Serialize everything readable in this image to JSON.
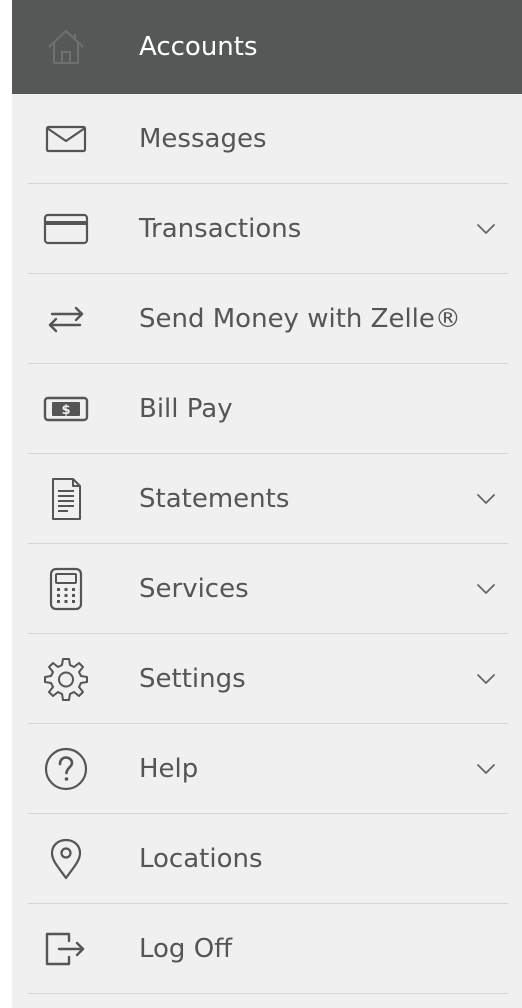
{
  "menu": {
    "items": [
      {
        "label": "Accounts",
        "icon": "home-icon",
        "active": true,
        "expandable": false
      },
      {
        "label": "Messages",
        "icon": "envelope-icon",
        "active": false,
        "expandable": false
      },
      {
        "label": "Transactions",
        "icon": "credit-card-icon",
        "active": false,
        "expandable": true
      },
      {
        "label": "Send Money with Zelle®",
        "icon": "transfer-arrows-icon",
        "active": false,
        "expandable": false
      },
      {
        "label": "Bill Pay",
        "icon": "dollar-bill-icon",
        "active": false,
        "expandable": false
      },
      {
        "label": "Statements",
        "icon": "document-icon",
        "active": false,
        "expandable": true
      },
      {
        "label": "Services",
        "icon": "calculator-icon",
        "active": false,
        "expandable": true
      },
      {
        "label": "Settings",
        "icon": "gear-icon",
        "active": false,
        "expandable": true
      },
      {
        "label": "Help",
        "icon": "question-circle-icon",
        "active": false,
        "expandable": true
      },
      {
        "label": "Locations",
        "icon": "map-pin-icon",
        "active": false,
        "expandable": false
      },
      {
        "label": "Log Off",
        "icon": "log-off-icon",
        "active": false,
        "expandable": false
      }
    ]
  },
  "colors": {
    "accent": "#1f6f5c",
    "active_background": "#555857",
    "menu_background": "#f0f0f0",
    "text": "#555555",
    "active_text": "#ffffff",
    "divider": "#d6d6d6"
  }
}
